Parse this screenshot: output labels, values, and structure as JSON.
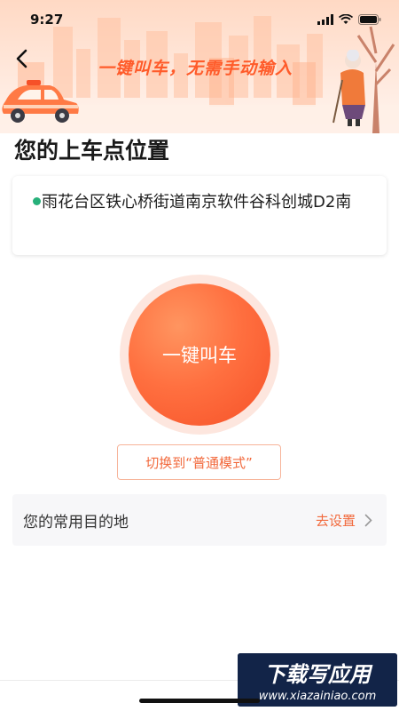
{
  "status_bar": {
    "time": "9:27"
  },
  "banner": {
    "slogan": "一键叫车，无需手动输入"
  },
  "page": {
    "title": "您的上车点位置"
  },
  "pickup": {
    "address": "雨花台区铁心桥街道南京软件谷科创城D2南"
  },
  "call": {
    "button_label": "一键叫车"
  },
  "mode_switch": {
    "label": "切换到“普通模式”"
  },
  "favorites": {
    "label": "您的常用目的地",
    "action_label": "去设置"
  },
  "watermark": {
    "title": "下载写应用",
    "url": "www.xiazainiao.com"
  },
  "colors": {
    "accent": "#f65128",
    "accent_light": "#ff9560",
    "dot": "#27b07a",
    "banner": "#ffe8dc"
  }
}
